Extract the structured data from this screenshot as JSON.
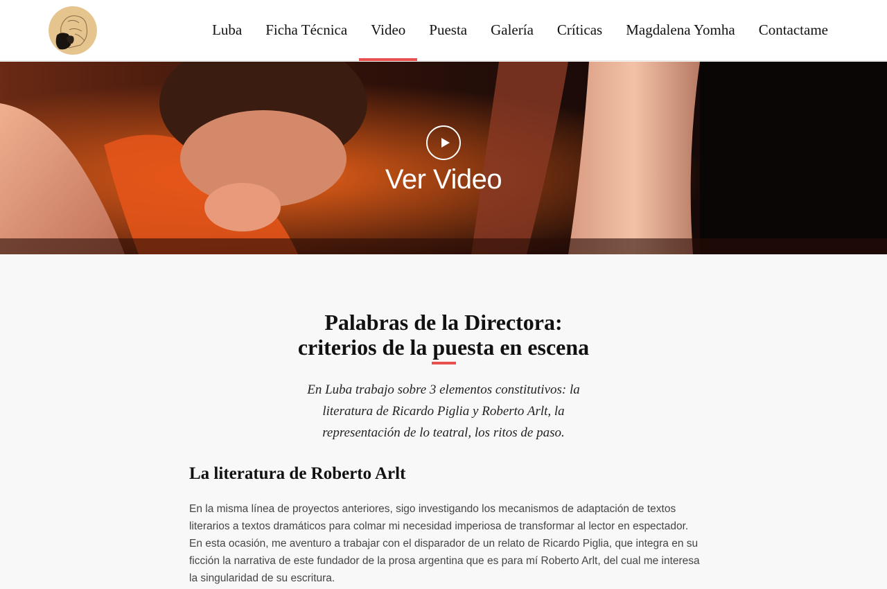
{
  "nav": {
    "items": [
      {
        "label": "Luba",
        "active": false
      },
      {
        "label": "Ficha Técnica",
        "active": false
      },
      {
        "label": "Video",
        "active": true
      },
      {
        "label": "Puesta",
        "active": false
      },
      {
        "label": "Galería",
        "active": false
      },
      {
        "label": "Críticas",
        "active": false
      },
      {
        "label": "Magdalena Yomha",
        "active": false
      },
      {
        "label": "Contactame",
        "active": false
      }
    ]
  },
  "hero": {
    "cta_label": "Ver Video",
    "play_icon": "play-circle-icon"
  },
  "section": {
    "title_line1": "Palabras de la Directora:",
    "title_line2": "criterios de la puesta en escena",
    "intro": "En Luba trabajo sobre 3 elementos constitutivos: la literatura de Ricardo Piglia y Roberto Arlt, la representación de lo teatral, los ritos de paso.",
    "subheading": "La literatura de Roberto Arlt",
    "body": "En la misma línea de proyectos anteriores, sigo investigando los mecanismos de adaptación de textos literarios a textos dramáticos para colmar mi necesidad imperiosa de transformar al lector en espectador. En esta ocasión, me aventuro a trabajar con el disparador de un relato de Ricardo Piglia, que integra en su ficción la narrativa de este fundador de la prosa argentina que es para mí Roberto Arlt, del cual me interesa la singularidad de su escritura."
  },
  "colors": {
    "accent": "#e8504f",
    "header_bg": "#ffffff",
    "page_bg": "#f8f8f8"
  }
}
